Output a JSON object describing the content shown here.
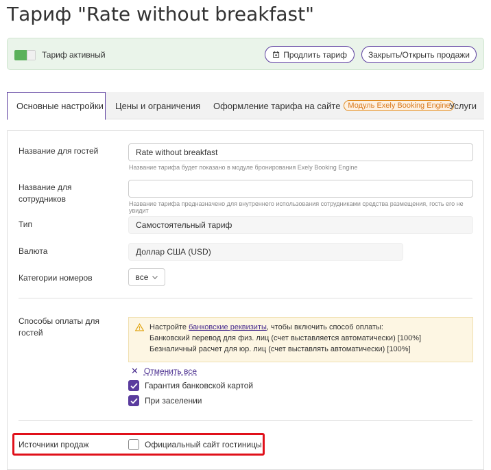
{
  "page": {
    "title": "Тариф \"Rate without breakfast\""
  },
  "status": {
    "toggle_state": "on",
    "label": "Тариф активный",
    "extend_button": "Продлить тариф",
    "close_open_button": "Закрыть/Открыть продажи"
  },
  "tabs": [
    {
      "label": "Основные настройки",
      "active": true
    },
    {
      "label": "Цены и ограничения",
      "active": false
    },
    {
      "label": "Оформление тарифа на сайте",
      "badge": "Модуль Exely Booking Engine",
      "active": false
    },
    {
      "label": "Услуги",
      "active": false
    }
  ],
  "form": {
    "guest_name": {
      "label": "Название для гостей",
      "value": "Rate without breakfast",
      "hint": "Название тарифа будет показано в модуле бронирования Exely Booking Engine"
    },
    "staff_name": {
      "label": "Название для сотрудников",
      "value": "",
      "hint": "Название тарифа предназначено для внутреннего использования сотрудниками средства размещения, гость его не увидит"
    },
    "type": {
      "label": "Тип",
      "value": "Самостоятельный тариф"
    },
    "currency": {
      "label": "Валюта",
      "value": "Доллар США (USD)"
    },
    "room_categories": {
      "label": "Категории номеров",
      "value": "все"
    },
    "payment_methods": {
      "label": "Способы оплаты для гостей",
      "warning_prefix": "Настройте ",
      "warning_link": "банковские реквизиты",
      "warning_suffix": ", чтобы включить способ оплаты:",
      "warning_line2": "Банковский перевод для физ. лиц (счет выставляется автоматически) [100%]",
      "warning_line3": "Безналичный расчет для юр. лиц (счет выставлять автоматически) [100%]",
      "cancel_all": "Отменить все",
      "options": [
        {
          "label": "Гарантия банковской картой",
          "checked": true
        },
        {
          "label": "При заселении",
          "checked": true
        }
      ]
    },
    "sales_sources": {
      "label": "Источники продаж",
      "option": {
        "label": "Официальный сайт гостиницы",
        "checked": false
      }
    }
  },
  "colors": {
    "accent": "#5a3c9e",
    "active_green": "#5bb15b",
    "warning_bg": "#fdf6e3",
    "badge_orange": "#d9781a",
    "highlight_red": "#e0101a"
  }
}
